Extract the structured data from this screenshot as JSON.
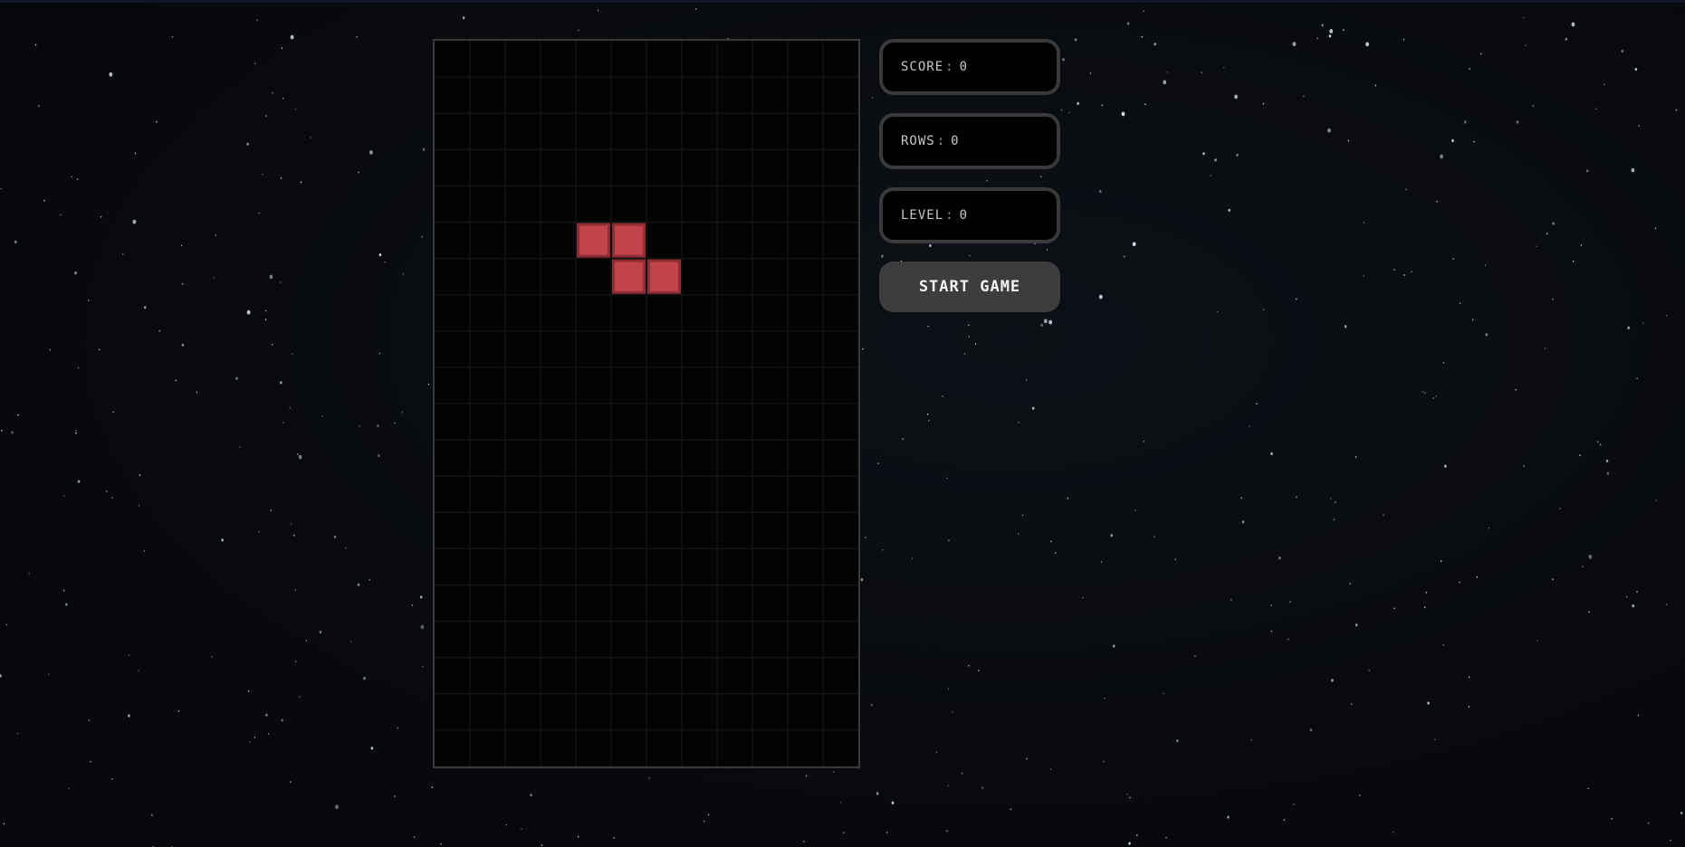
{
  "game": {
    "board": {
      "columns": 12,
      "rows": 20,
      "background_color": "#030303",
      "grid_line_color": "#1a1a1a",
      "border_color": "#3a3a3a"
    },
    "active_piece": {
      "shape": "Z",
      "color": "#c0444a",
      "cells": [
        {
          "col": 4,
          "row": 5
        },
        {
          "col": 5,
          "row": 5
        },
        {
          "col": 5,
          "row": 6
        },
        {
          "col": 6,
          "row": 6
        }
      ]
    }
  },
  "stats": {
    "score_label": "Score",
    "score_value": "0",
    "rows_label": "Rows",
    "rows_value": "0",
    "level_label": "Level",
    "level_value": "0"
  },
  "controls": {
    "start_label": "Start Game"
  },
  "theme": {
    "background": "starfield",
    "panel_border": "#3a3a3a",
    "button_bg": "#3d3d3d"
  }
}
